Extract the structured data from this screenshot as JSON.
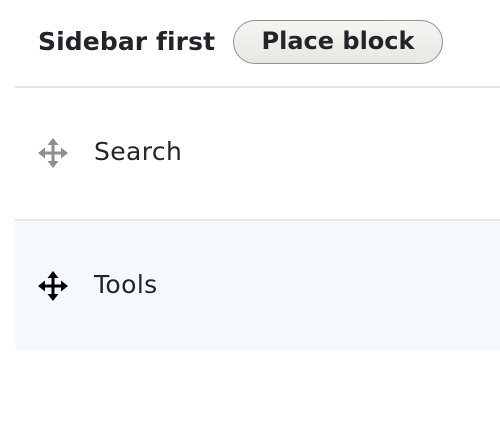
{
  "region": {
    "title": "Sidebar first",
    "place_block_label": "Place block"
  },
  "blocks": [
    {
      "label": "Search",
      "icon": "move-icon",
      "icon_color": "#8e8e8e"
    },
    {
      "label": "Tools",
      "icon": "move-icon",
      "icon_color": "#000000",
      "highlighted": true,
      "highlight_color": "#f5f9fd"
    }
  ]
}
